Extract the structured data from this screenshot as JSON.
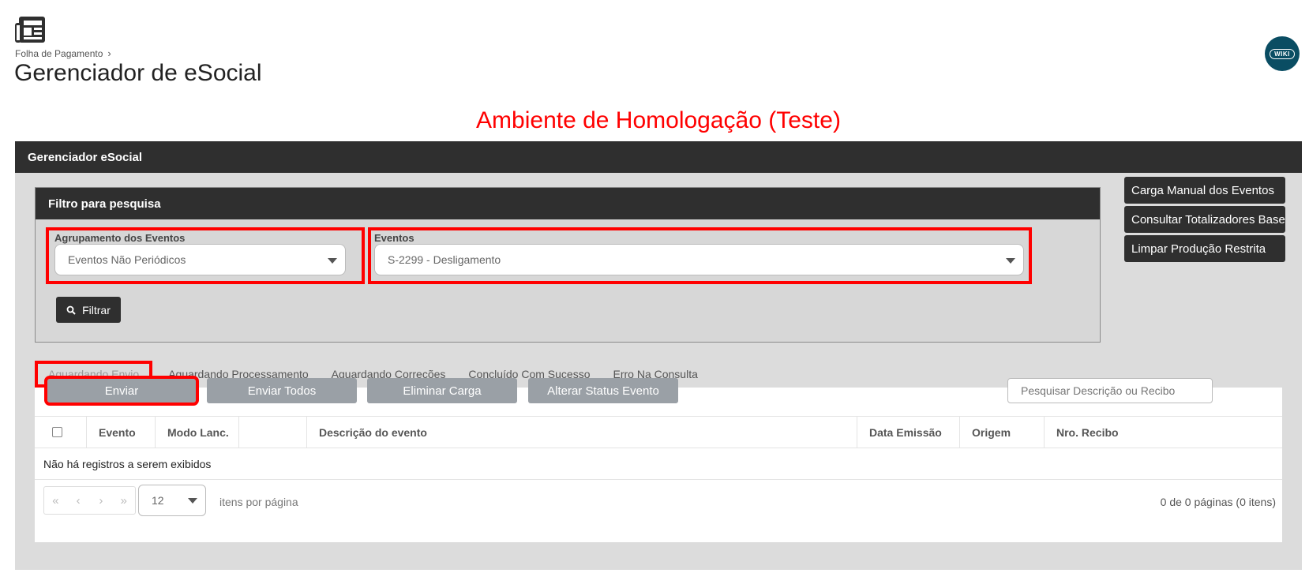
{
  "breadcrumb": {
    "parent": "Folha de Pagamento"
  },
  "page": {
    "title": "Gerenciador de eSocial",
    "wiki_label": "WIKI"
  },
  "environment_banner": "Ambiente de Homologação (Teste)",
  "panel": {
    "title": "Gerenciador eSocial"
  },
  "filter": {
    "title": "Filtro para pesquisa",
    "grouping_label": "Agrupamento dos Eventos",
    "grouping_value": "Eventos Não Periódicos",
    "events_label": "Eventos",
    "events_value": "S-2299 - Desligamento",
    "filter_button": "Filtrar"
  },
  "side_buttons": {
    "manual_load": "Carga Manual dos Eventos",
    "totals": "Consultar Totalizadores Base",
    "clear_restricted": "Limpar Produção Restrita"
  },
  "tabs": [
    "Aguardando Envio",
    "Aguardando Processamento",
    "Aguardando Correções",
    "Concluído Com Sucesso",
    "Erro Na Consulta"
  ],
  "actions": {
    "send": "Enviar",
    "send_all": "Enviar Todos",
    "remove_load": "Eliminar Carga",
    "change_status": "Alterar Status Evento",
    "search_placeholder": "Pesquisar Descrição ou Recibo"
  },
  "grid": {
    "columns": [
      "Evento",
      "Modo Lanc.",
      "",
      "Descrição do evento",
      "Data Emissão",
      "Origem",
      "Nro. Recibo"
    ],
    "empty_message": "Não há registros a serem exibidos"
  },
  "pagination": {
    "page_size": "12",
    "per_page_label": "itens por página",
    "info": "0 de 0 páginas (0 itens)"
  },
  "colors": {
    "accent_red": "#ff0000",
    "header_dark": "#2f2f2f",
    "button_gray": "#9aa0a6",
    "wiki_blue": "#0a4d63"
  }
}
